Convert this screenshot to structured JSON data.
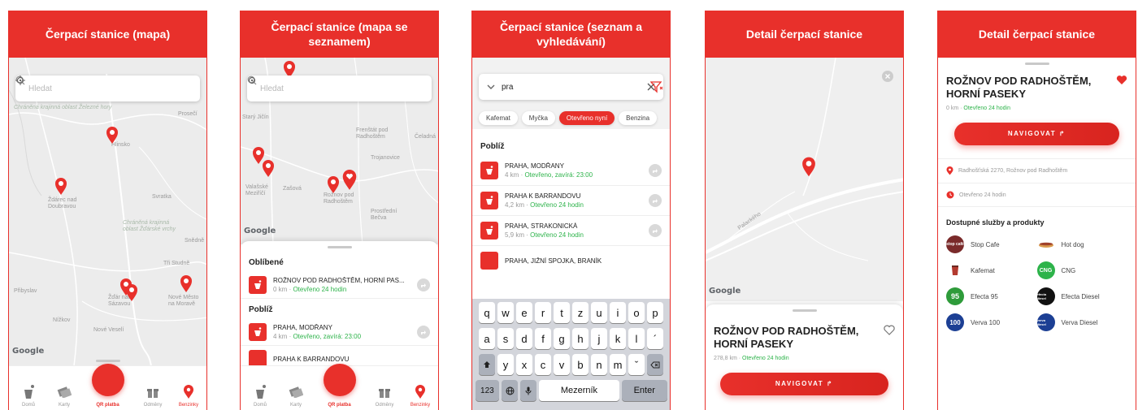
{
  "accent": "#e8302b",
  "screens": [
    {
      "title": "Čerpací stanice (mapa)",
      "search_placeholder": "Hledat",
      "map_labels": [
        "Chráněná krajinná oblast Železné hory",
        "Prosečí",
        "Hlinsko",
        "Ždárec nad Doubravou",
        "Svratka",
        "Chráněná krajinná oblast Žďárské vrchy",
        "Snědně",
        "Tři Studně",
        "Přibyslav",
        "Žďár nad Sázavou",
        "Nové Město na Moravě",
        "Nížkov",
        "Nové Veselí"
      ],
      "google": "Google"
    },
    {
      "title": "Čerpací stanice (mapa se seznamem)",
      "search_placeholder": "Hledat",
      "map_labels": [
        "Starý Jičín",
        "Frenštát pod Radhoštěm",
        "Čeladná",
        "Trojanovice",
        "Valašské Meziříčí",
        "Zašová",
        "Rožnov pod Radhoštěm",
        "Prostřední Bečva"
      ],
      "google": "Google",
      "favorites_title": "Oblíbené",
      "favorites": [
        {
          "name": "ROŽNOV POD RADHOŠTĚM, HORNÍ PAS...",
          "dist": "0 km",
          "status": "Otevřeno 24 hodin"
        }
      ],
      "nearby_title": "Poblíž",
      "nearby": [
        {
          "name": "PRAHA, MODŘANY",
          "dist": "4 km",
          "status": "Otevřeno, zavírá: 23:00"
        },
        {
          "name": "PRAHA K BARRANDOVU",
          "dist": "",
          "status": ""
        }
      ]
    },
    {
      "title": "Čerpací stanice (seznam a vyhledávání)",
      "query": "pra",
      "chips": [
        "Kafemat",
        "Myčka",
        "Otevřeno nyní",
        "Benzina"
      ],
      "nearby_title": "Poblíž",
      "results": [
        {
          "name": "PRAHA, MODŘANY",
          "dist": "4 km",
          "status": "Otevřeno, zavírá: 23:00"
        },
        {
          "name": "PRAHA K BARRANDOVU",
          "dist": "4,2 km",
          "status": "Otevřeno 24 hodin"
        },
        {
          "name": "PRAHA, STRAKONICKÁ",
          "dist": "5,9 km",
          "status": "Otevřeno 24 hodin"
        },
        {
          "name": "PRAHA, JIŽNÍ SPOJKA, BRANÍK",
          "dist": "",
          "status": ""
        }
      ],
      "keyboard": {
        "row1": [
          "q",
          "w",
          "e",
          "r",
          "t",
          "z",
          "u",
          "i",
          "o",
          "p"
        ],
        "row2": [
          "a",
          "s",
          "d",
          "f",
          "g",
          "h",
          "j",
          "k",
          "l",
          "´"
        ],
        "row3": [
          "y",
          "x",
          "c",
          "v",
          "b",
          "n",
          "m",
          "ˇ"
        ],
        "num": "123",
        "space": "Mezerník",
        "enter": "Enter"
      }
    },
    {
      "title": "Detail čerpací stanice",
      "map_labels": [
        "Palackého"
      ],
      "google": "Google",
      "station": "ROŽNOV POD RADHOŠTĚM, HORNÍ PASEKY",
      "dist": "278,8 km",
      "status": "Otevřeno 24 hodin",
      "navigate": "NAVIGOVAT"
    },
    {
      "title": "Detail čerpací stanice",
      "station": "ROŽNOV POD RADHOŠTĚM, HORNÍ PASEKY",
      "dist": "0 km",
      "status": "Otevřeno 24 hodin",
      "navigate": "NAVIGOVAT",
      "address": "Radhošťská 2270, Rožnov pod Radhoštěm",
      "hours": "Otevřeno 24 hodin",
      "services_title": "Dostupné služby a produkty",
      "services": [
        "Stop Cafe",
        "Hot dog",
        "Kafemat",
        "CNG",
        "Efecta 95",
        "Efecta Diesel",
        "Verva 100",
        "Verva Diesel"
      ],
      "badges": {
        "stop": "stop café",
        "cng": "CNG",
        "e95": "95",
        "ediesel": "efecta diesel",
        "v100": "100",
        "vdiesel": "verva diesel"
      }
    }
  ],
  "tabbar": {
    "home": "Domů",
    "cards": "Karty",
    "qr": "QR platba",
    "rewards": "Odměny",
    "stations": "Benzinky"
  }
}
